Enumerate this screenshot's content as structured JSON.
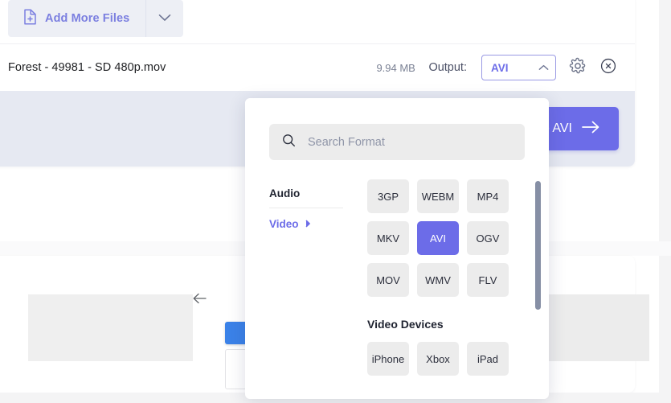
{
  "toolbar": {
    "add_files_label": "Add More Files",
    "add_files_icon": "document-plus-icon",
    "caret_icon": "chevron-down-icon"
  },
  "file_row": {
    "name": "Forest - 49981 - SD 480p.mov",
    "size": "9.94 MB",
    "output_label": "Output:",
    "output_value": "AVI",
    "output_caret_icon": "chevron-up-icon",
    "settings_icon": "gear-icon",
    "remove_icon": "close-circle-icon"
  },
  "convert": {
    "label": "Convert to AVI",
    "arrow_icon": "arrow-right-icon"
  },
  "format_dropdown": {
    "search": {
      "placeholder": "Search Format",
      "value": "",
      "icon": "search-icon"
    },
    "categories": [
      {
        "label": "Audio",
        "active": false
      },
      {
        "label": "Video",
        "active": true,
        "arrow_icon": "chevron-right-icon"
      }
    ],
    "formats": [
      "3GP",
      "WEBM",
      "MP4",
      "MKV",
      "AVI",
      "OGV",
      "MOV",
      "WMV",
      "FLV"
    ],
    "selected_format": "AVI",
    "devices_title": "Video Devices",
    "devices": [
      "iPhone",
      "Xbox",
      "iPad"
    ]
  },
  "preview": {
    "back_icon": "arrow-left-icon"
  },
  "colors": {
    "accent": "#6c6ce8",
    "accent_soft": "#7b7fe0",
    "chip_bg": "#ececec",
    "strip_bg": "#e6e9f2",
    "blue_box": "#3b82e8",
    "scrollbar": "#868fa5"
  }
}
